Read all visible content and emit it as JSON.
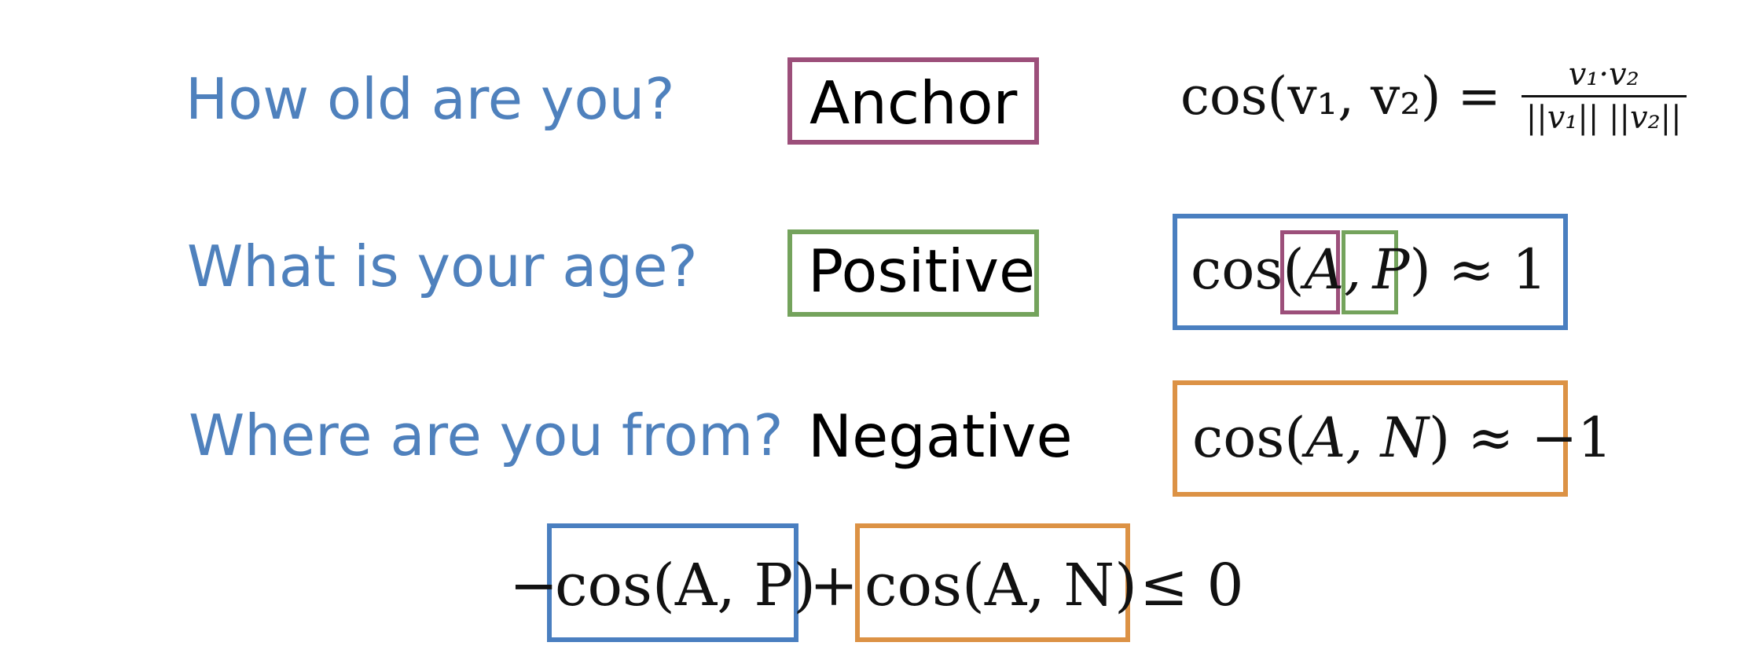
{
  "colors": {
    "question": "#4f81bd",
    "anchor": "#9c4f7a",
    "positive": "#74a35c",
    "cos_pos_box": "#4a7fc0",
    "cos_neg_box": "#dc9245",
    "text": "#000000"
  },
  "questions": {
    "q1": "How old are you?",
    "q2": "What is your age?",
    "q3": "Where are you from?"
  },
  "roles": {
    "anchor": "Anchor",
    "positive": "Positive",
    "negative": "Negative"
  },
  "formula_cosine": {
    "lhs": "cos(v₁, v₂) =",
    "numerator": "v₁·v₂",
    "denominator": "||v₁|| ||v₂||"
  },
  "formula_ap": {
    "prefix": "cos(",
    "a": "A,",
    "p": "P",
    "suffix": ") ≈ 1"
  },
  "formula_an": {
    "prefix": "cos(",
    "args": "A, N",
    "suffix": ") ≈ −1"
  },
  "loss": {
    "minus": "−",
    "term_ap": "cos(A, P)",
    "plus": "+",
    "term_an": "cos(A, N)",
    "rhs": "≤ 0"
  }
}
